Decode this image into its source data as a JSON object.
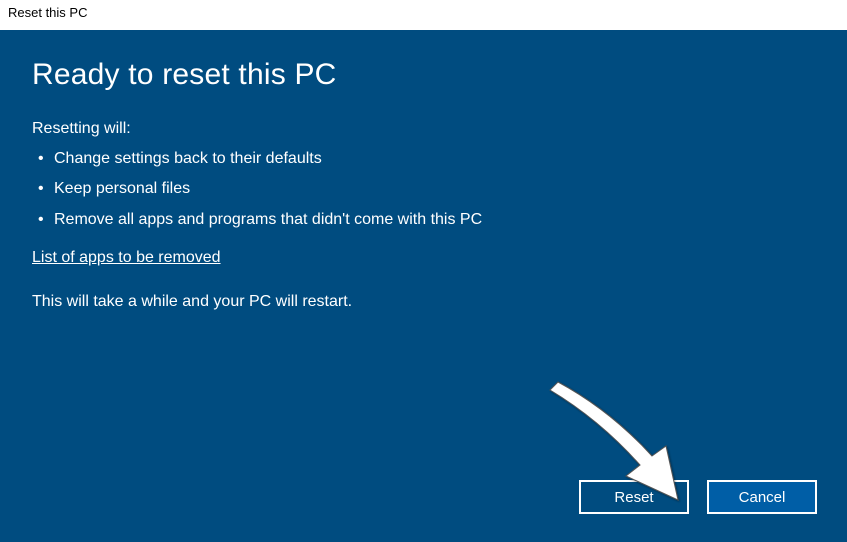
{
  "window": {
    "title": "Reset this PC"
  },
  "dialog": {
    "heading": "Ready to reset this PC",
    "subheading": "Resetting will:",
    "bullets": [
      "Change settings back to their defaults",
      "Keep personal files",
      "Remove all apps and programs that didn't come with this PC"
    ],
    "link_text": "List of apps to be removed",
    "note": "This will take a while and your PC will restart."
  },
  "buttons": {
    "reset": "Reset",
    "cancel": "Cancel"
  },
  "colors": {
    "dialog_bg": "#004c80",
    "primary_btn": "#005ea6"
  }
}
